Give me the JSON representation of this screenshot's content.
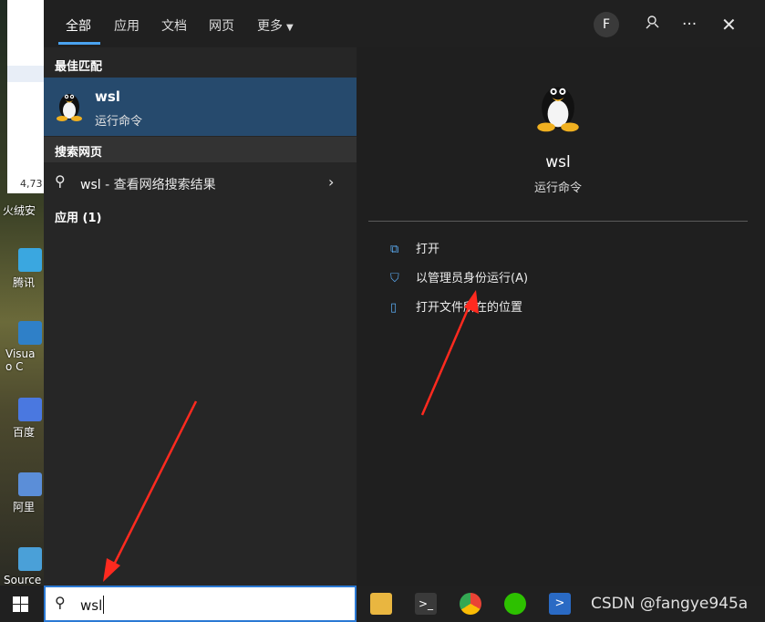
{
  "desktop": {
    "window_count": "4,73",
    "icons": [
      {
        "label": "火绒安"
      },
      {
        "label": "腾讯"
      },
      {
        "label": "Visua"
      },
      {
        "label": "o C"
      },
      {
        "label": "百度"
      },
      {
        "label": "阿里"
      },
      {
        "label": "Source"
      }
    ]
  },
  "start_menu": {
    "tabs": [
      {
        "label": "全部"
      },
      {
        "label": "应用"
      },
      {
        "label": "文档"
      },
      {
        "label": "网页"
      },
      {
        "label": "更多"
      }
    ],
    "avatar_letter": "F",
    "top_icons": [
      "feedback-icon",
      "more-icon",
      "close-icon"
    ],
    "left": {
      "best_match_label": "最佳匹配",
      "best_match": {
        "name": "wsl",
        "type": "运行命令"
      },
      "web_label": "搜索网页",
      "web_item": {
        "query": "wsl",
        "suffix": " - 查看网络搜索结果"
      },
      "apps_label": "应用 (1)"
    },
    "right": {
      "name": "wsl",
      "type": "运行命令",
      "actions": [
        {
          "label": "打开",
          "icon": "open-icon"
        },
        {
          "label": "以管理员身份运行(A)",
          "icon": "shield-icon"
        },
        {
          "label": "打开文件所在的位置",
          "icon": "folder-location-icon"
        }
      ]
    }
  },
  "taskbar": {
    "search_value": "wsl",
    "apps": [
      "file-explorer-icon",
      "terminal-icon",
      "chrome-icon",
      "wechat-icon",
      "powershell-icon"
    ],
    "watermark": "CSDN @fangye945a"
  },
  "colors": {
    "accent": "#4aa3f0",
    "selection": "#264a6d",
    "annotation_arrow": "#ff2a1f"
  }
}
